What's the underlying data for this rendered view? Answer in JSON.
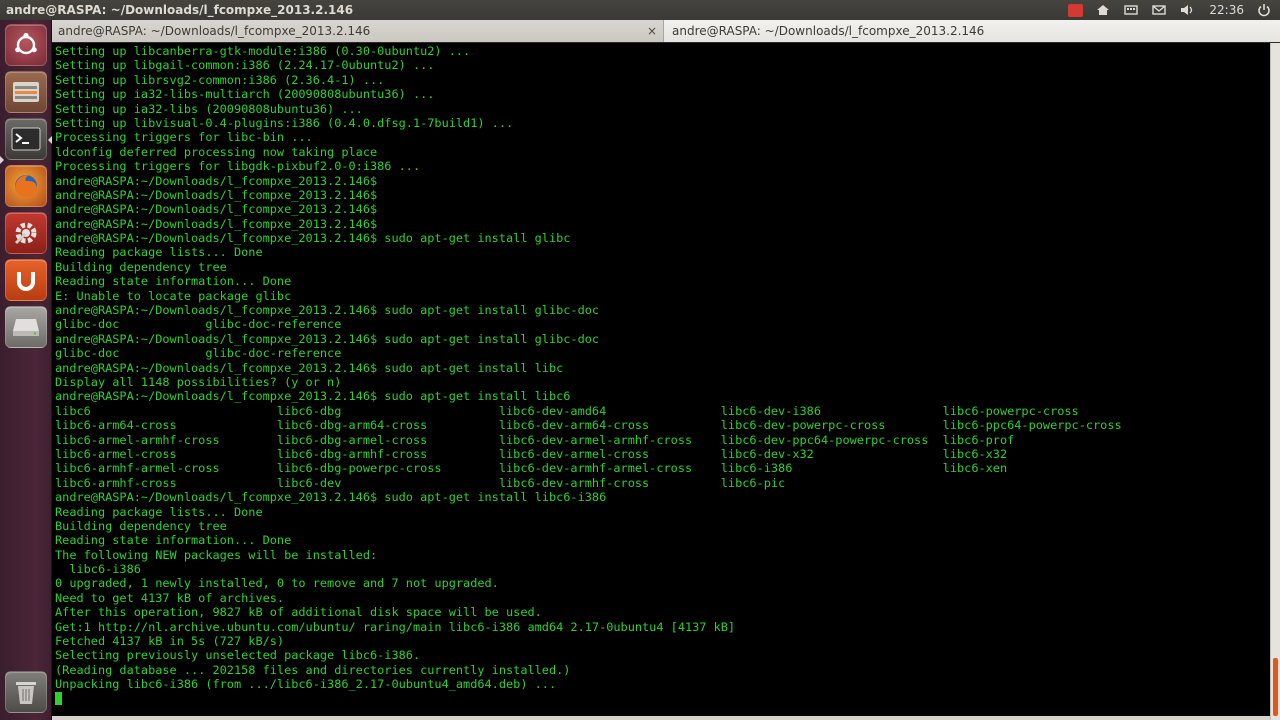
{
  "top_panel": {
    "window_title": "andre@RASPA: ~/Downloads/l_fcompxe_2013.2.146",
    "clock": "22:36",
    "indicators": [
      "record-icon",
      "network-icon",
      "keyboard-icon",
      "mail-icon",
      "volume-icon",
      "power-icon"
    ]
  },
  "launcher": {
    "items": [
      "dash-home-icon",
      "file-manager-icon",
      "terminal-icon",
      "firefox-icon",
      "system-settings-icon",
      "ubuntu-one-icon",
      "drive-icon",
      "trash-icon"
    ]
  },
  "tabs": [
    {
      "label": "andre@RASPA: ~/Downloads/l_fcompxe_2013.2.146",
      "close": "×"
    },
    {
      "label": "andre@RASPA: ~/Downloads/l_fcompxe_2013.2.146"
    }
  ],
  "terminal": {
    "colors": {
      "foreground": "#2ed12e",
      "background": "#000000"
    },
    "lines": [
      "Setting up libcanberra-gtk-module:i386 (0.30-0ubuntu2) ...",
      "Setting up libgail-common:i386 (2.24.17-0ubuntu2) ...",
      "Setting up librsvg2-common:i386 (2.36.4-1) ...",
      "Setting up ia32-libs-multiarch (20090808ubuntu36) ...",
      "Setting up ia32-libs (20090808ubuntu36) ...",
      "Setting up libvisual-0.4-plugins:i386 (0.4.0.dfsg.1-7build1) ...",
      "Processing triggers for libc-bin ...",
      "ldconfig deferred processing now taking place",
      "Processing triggers for libgdk-pixbuf2.0-0:i386 ...",
      "andre@RASPA:~/Downloads/l_fcompxe_2013.2.146$",
      "andre@RASPA:~/Downloads/l_fcompxe_2013.2.146$",
      "andre@RASPA:~/Downloads/l_fcompxe_2013.2.146$",
      "andre@RASPA:~/Downloads/l_fcompxe_2013.2.146$",
      "andre@RASPA:~/Downloads/l_fcompxe_2013.2.146$ sudo apt-get install glibc",
      "Reading package lists... Done",
      "Building dependency tree",
      "Reading state information... Done",
      "E: Unable to locate package glibc",
      "andre@RASPA:~/Downloads/l_fcompxe_2013.2.146$ sudo apt-get install glibc-doc",
      "glibc-doc            glibc-doc-reference",
      "andre@RASPA:~/Downloads/l_fcompxe_2013.2.146$ sudo apt-get install glibc-doc",
      "glibc-doc            glibc-doc-reference",
      "andre@RASPA:~/Downloads/l_fcompxe_2013.2.146$ sudo apt-get install libc",
      "Display all 1148 possibilities? (y or n)",
      "andre@RASPA:~/Downloads/l_fcompxe_2013.2.146$ sudo apt-get install libc6",
      "libc6                          libc6-dbg                      libc6-dev-amd64                libc6-dev-i386                 libc6-powerpc-cross",
      "libc6-arm64-cross              libc6-dbg-arm64-cross          libc6-dev-arm64-cross          libc6-dev-powerpc-cross        libc6-ppc64-powerpc-cross",
      "libc6-armel-armhf-cross        libc6-dbg-armel-cross          libc6-dev-armel-armhf-cross    libc6-dev-ppc64-powerpc-cross  libc6-prof",
      "libc6-armel-cross              libc6-dbg-armhf-cross          libc6-dev-armel-cross          libc6-dev-x32                  libc6-x32",
      "libc6-armhf-armel-cross        libc6-dbg-powerpc-cross        libc6-dev-armhf-armel-cross    libc6-i386                     libc6-xen",
      "libc6-armhf-cross              libc6-dev                      libc6-dev-armhf-cross          libc6-pic",
      "andre@RASPA:~/Downloads/l_fcompxe_2013.2.146$ sudo apt-get install libc6-i386",
      "Reading package lists... Done",
      "Building dependency tree",
      "Reading state information... Done",
      "The following NEW packages will be installed:",
      "  libc6-i386",
      "0 upgraded, 1 newly installed, 0 to remove and 7 not upgraded.",
      "Need to get 4137 kB of archives.",
      "After this operation, 9827 kB of additional disk space will be used.",
      "Get:1 http://nl.archive.ubuntu.com/ubuntu/ raring/main libc6-i386 amd64 2.17-0ubuntu4 [4137 kB]",
      "Fetched 4137 kB in 5s (727 kB/s)",
      "Selecting previously unselected package libc6-i386.",
      "(Reading database ... 202158 files and directories currently installed.)",
      "Unpacking libc6-i386 (from .../libc6-i386_2.17-0ubuntu4_amd64.deb) ..."
    ]
  }
}
